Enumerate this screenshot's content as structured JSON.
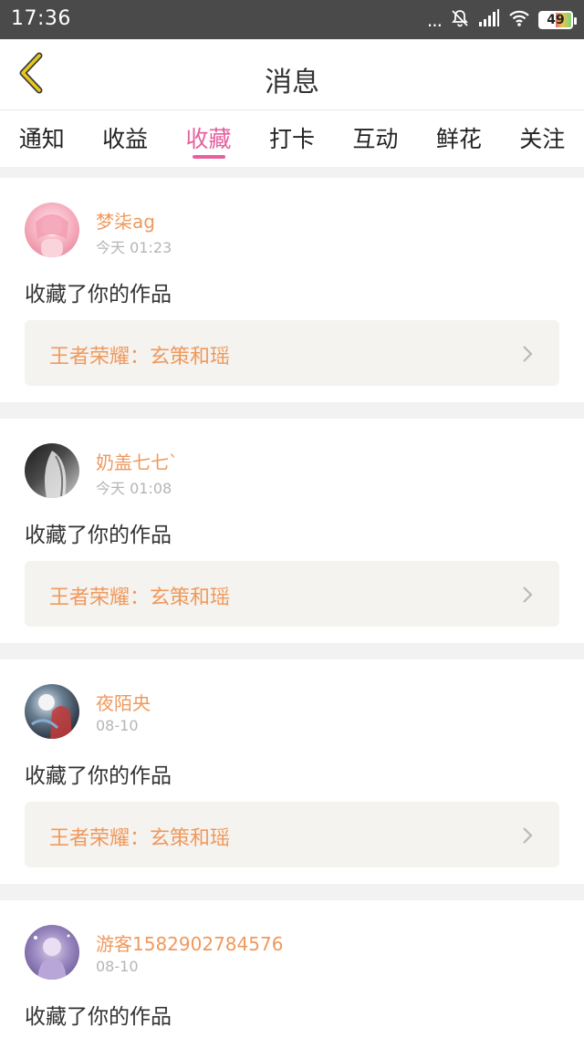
{
  "status_bar": {
    "time": "17:36",
    "battery": "49",
    "dots": "..."
  },
  "header": {
    "title": "消息"
  },
  "tabs": [
    {
      "label": "通知"
    },
    {
      "label": "收益"
    },
    {
      "label": "收藏",
      "active": true
    },
    {
      "label": "打卡"
    },
    {
      "label": "互动"
    },
    {
      "label": "鲜花"
    },
    {
      "label": "关注"
    }
  ],
  "items": [
    {
      "name": "梦柒ag",
      "time": "今天 01:23",
      "message": "收藏了你的作品",
      "work": "王者荣耀：玄策和瑶"
    },
    {
      "name": "奶盖七七`",
      "time": "今天 01:08",
      "message": "收藏了你的作品",
      "work": "王者荣耀：玄策和瑶"
    },
    {
      "name": "夜陌央",
      "time": "08-10",
      "message": "收藏了你的作品",
      "work": "王者荣耀：玄策和瑶"
    },
    {
      "name": "游客1582902784576",
      "time": "08-10",
      "message": "收藏了你的作品"
    }
  ],
  "colors": {
    "accent_pink": "#e6609e",
    "accent_orange": "#f0995d",
    "back_icon_yellow": "#e8c81c"
  }
}
